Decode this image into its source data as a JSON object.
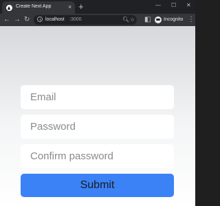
{
  "browser": {
    "tab": {
      "title": "Create Next App",
      "close_icon": "×"
    },
    "new_tab_icon": "+",
    "window_controls": {
      "minimize": "—",
      "maximize": "☐",
      "close": "✕"
    },
    "toolbar": {
      "back": "←",
      "forward": "→",
      "reload": "↻"
    },
    "address": {
      "host": "localhost",
      "port": ":3000"
    },
    "omnibox_icons": {
      "zoom": "🔍︎",
      "bookmark": "☆"
    },
    "side_panel_icon": "◧",
    "profile": {
      "label": "Incognito"
    },
    "menu_icon": "⋮"
  },
  "form": {
    "email": {
      "placeholder": "Email",
      "value": ""
    },
    "password": {
      "placeholder": "Password",
      "value": ""
    },
    "confirm_password": {
      "placeholder": "Confirm password",
      "value": ""
    },
    "submit_label": "Submit"
  },
  "colors": {
    "submit_background": "#3b82f6",
    "page_background_top": "#d6d8db",
    "page_background_bottom": "#ffffff",
    "browser_frame": "#202124",
    "browser_toolbar": "#35363a"
  }
}
